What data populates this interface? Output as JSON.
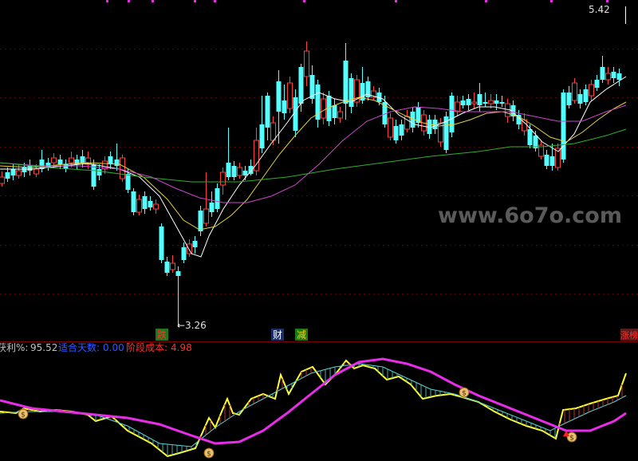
{
  "price_pane": {
    "high_label": "5.42",
    "low_label": "←3.26",
    "watermark": "www.6o7o.com",
    "event_tags": [
      {
        "text": "跌",
        "color": "#ff3030",
        "bg": "#1a7a1a"
      },
      {
        "text": "财",
        "color": "#ffffff",
        "bg": "#1a2f6a"
      },
      {
        "text": "减",
        "color": "#ffd000",
        "bg": "#1a7a1a"
      },
      {
        "text": "涨榜",
        "color": "#ff3030",
        "bg": "#5a1a1a"
      }
    ]
  },
  "indicator_pane": {
    "label_profit": "获利%:",
    "value_profit": "95.52",
    "label_days": "适合天数:",
    "value_days": "0.00",
    "label_cost": "阶段成本:",
    "value_cost": "4.98",
    "colors": {
      "profit": "#c0c0c0",
      "days": "#2d5bff",
      "cost": "#ff3030"
    }
  },
  "colors": {
    "up": "#ff4040",
    "down": "#54ffff",
    "ma5": "#ffffff",
    "ma10": "#e6d23c",
    "ma20": "#cc44cc",
    "ma60": "#2fae2f",
    "osc_fast": "#ffff30",
    "osc_mid": "#5dd6d6",
    "osc_slow": "#e82ce8"
  }
}
